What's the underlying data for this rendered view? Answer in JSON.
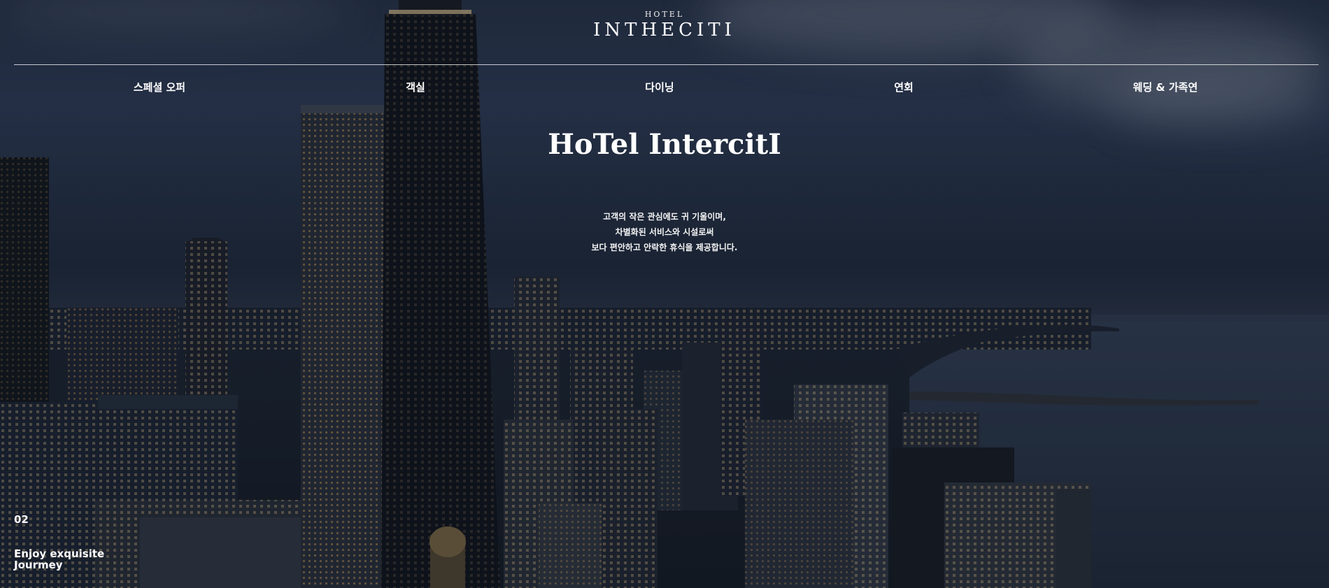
{
  "header": {
    "logo_small": "HOTEL",
    "logo_main": "INTHECITI"
  },
  "nav": {
    "items": [
      {
        "label": "스페셜 오퍼"
      },
      {
        "label": "객실"
      },
      {
        "label": "다이닝"
      },
      {
        "label": "연회"
      },
      {
        "label": "웨딩 & 가족연"
      }
    ]
  },
  "hero": {
    "title": "HoTel IntercitI",
    "description_lines": [
      "고객의 작은 관심에도 귀 기울이며,",
      "차별화된 서비스와 시설로써",
      "보다 편안하고 안락한 휴식을 제공합니다."
    ]
  },
  "slide": {
    "number": "02",
    "caption_line1": "Enjoy exquisite",
    "caption_line2": "Jourmey"
  }
}
